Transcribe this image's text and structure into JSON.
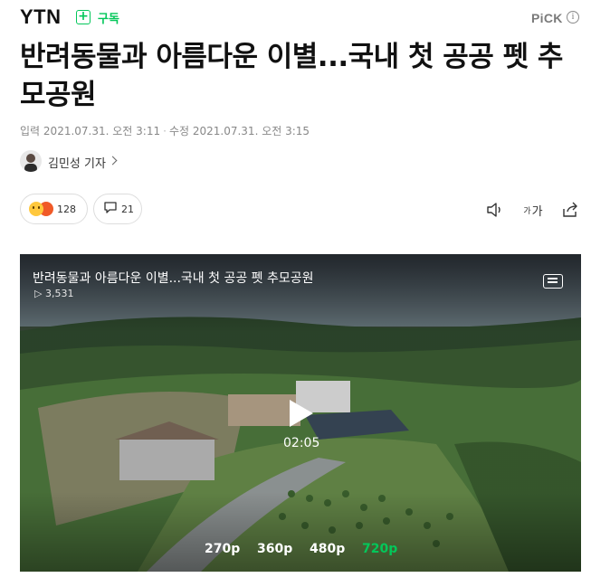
{
  "header": {
    "brand": "YTN",
    "subscribe_label": "구독",
    "pick_label": "PiCK",
    "pick_info": "i"
  },
  "article": {
    "title": "반려동물과 아름다운 이별...국내 첫 공공 펫 추모공원",
    "published_label": "입력",
    "published": "2021.07.31. 오전 3:11",
    "modified_label": "수정",
    "modified": "2021.07.31. 오전 3:15",
    "reporter": "김민성 기자"
  },
  "actions": {
    "reaction_count": "128",
    "comment_count": "21",
    "font_small": "가",
    "font_large": "가"
  },
  "video": {
    "title": "반려동물과 아름다운 이별...국내 첫 공공 펫 추모공원",
    "views": "3,531",
    "views_icon": "▷",
    "duration": "02:05",
    "qualities": [
      "270p",
      "360p",
      "480p",
      "720p"
    ],
    "selected_quality": "720p"
  },
  "colors": {
    "accent": "#03c75a",
    "text": "#111111",
    "muted": "#888888"
  },
  "icons": [
    "plus-icon",
    "info-icon",
    "chevron-right-icon",
    "sound-icon",
    "share-icon",
    "comment-icon",
    "menu-icon",
    "play-icon"
  ]
}
